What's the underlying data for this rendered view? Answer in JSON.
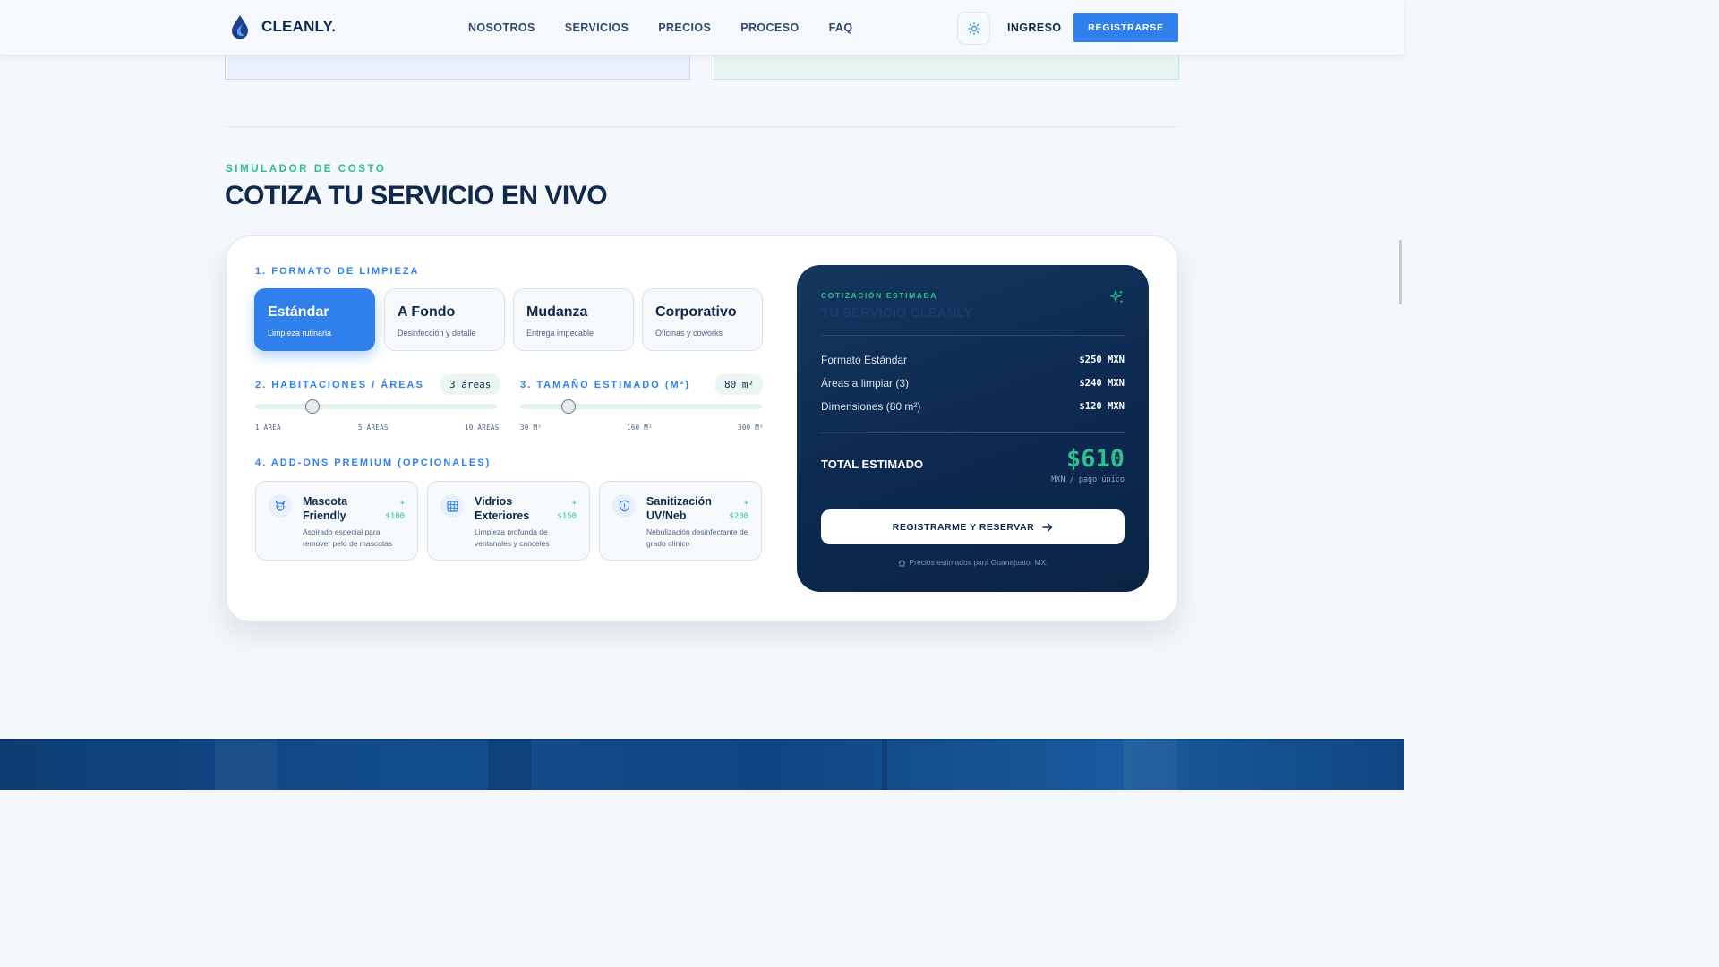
{
  "brand": {
    "name": "CLEANLY."
  },
  "nav": {
    "links": [
      "NOSOTROS",
      "SERVICIOS",
      "PRECIOS",
      "PROCESO",
      "FAQ"
    ],
    "login": "INGRESO",
    "register": "REGISTRARSE"
  },
  "section": {
    "eyebrow": "SIMULADOR DE COSTO",
    "title": "COTIZA TU SERVICIO EN VIVO"
  },
  "simulator": {
    "format_label": "1. FORMATO DE LIMPIEZA",
    "formats": [
      {
        "title": "Estándar",
        "subtitle": "Limpieza rutinaria",
        "selected": true
      },
      {
        "title": "A Fondo",
        "subtitle": "Desinfección y detalle",
        "selected": false
      },
      {
        "title": "Mudanza",
        "subtitle": "Entrega impecable",
        "selected": false
      },
      {
        "title": "Corporativo",
        "subtitle": "Oficinas y coworks",
        "selected": false
      }
    ],
    "rooms": {
      "label": "2. HABITACIONES / ÁREAS",
      "value_display": "3 áreas",
      "value": 3,
      "min": 1,
      "max": 10,
      "ticks": [
        "1 ÁREA",
        "5 ÁREAS",
        "10 ÁREAS"
      ]
    },
    "size": {
      "label": "3. TAMAÑO ESTIMADO (M²)",
      "value_display": "80 m²",
      "value": 80,
      "min": 30,
      "max": 300,
      "ticks": [
        "30 M²",
        "160 M²",
        "300 M²"
      ]
    },
    "addons_label": "4. ADD-ONS PREMIUM (OPCIONALES)",
    "addons": [
      {
        "icon": "pet-icon",
        "title": "Mascota Friendly",
        "price_plus": "+",
        "price": "$100",
        "desc": "Aspirado especial para remover pelo de mascotas"
      },
      {
        "icon": "window-grid-icon",
        "title": "Vidrios Exteriores",
        "price_plus": "+",
        "price": "$150",
        "desc": "Limpieza profunda de ventanales y canceles"
      },
      {
        "icon": "shield-icon",
        "title": "Sanitización UV/Neb",
        "price_plus": "+",
        "price": "$200",
        "desc": "Nebulización desinfectante de grado clínico"
      }
    ]
  },
  "quote": {
    "eyebrow": "COTIZACIÓN ESTIMADA",
    "ghost_title": "TU SERVICIO CLEANLY",
    "rows": [
      {
        "label": "Formato Estándar",
        "value": "$250 MXN"
      },
      {
        "label": "Áreas a limpiar (3)",
        "value": "$240 MXN"
      },
      {
        "label": "Dimensiones (80 m²)",
        "value": "$120 MXN"
      }
    ],
    "total_label": "TOTAL ESTIMADO",
    "total": "$610",
    "total_sub": "MXN / pago único",
    "cta": "REGISTRARME Y RESERVAR",
    "note": "Precios estimados para Guanajuato, MX."
  },
  "colors": {
    "primary": "#2f80ed",
    "accent": "#2dbf8f",
    "navy": "#0f2a4d",
    "panel": "#0c2950"
  }
}
